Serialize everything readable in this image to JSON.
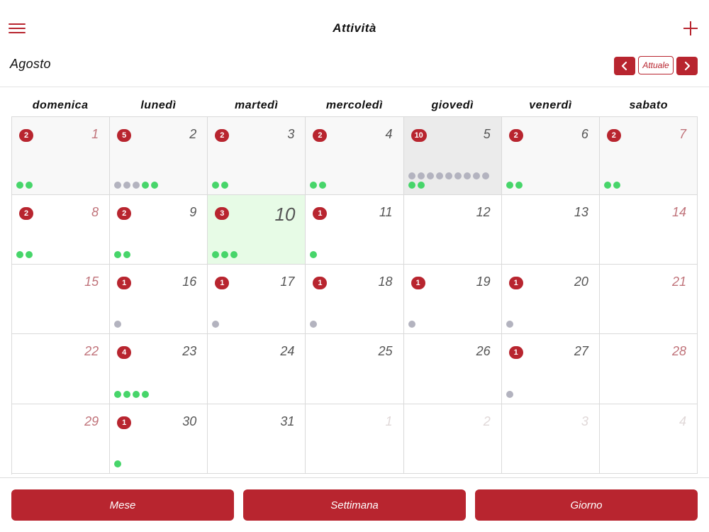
{
  "header": {
    "title": "Attività",
    "month": "Agosto",
    "today_label": "Attuale"
  },
  "colors": {
    "accent": "#b8252f",
    "event_green": "#47d56a",
    "event_gray": "#b3b3bf",
    "today_bg": "#e7fbe6",
    "selected_bg": "#ebebeb"
  },
  "weekdays": [
    "domenica",
    "lunedì",
    "martedì",
    "mercoledì",
    "giovedì",
    "venerdì",
    "sabato"
  ],
  "weeks": [
    [
      {
        "day": "1",
        "badge": "2",
        "dots": [
          "green",
          "green"
        ],
        "weekend": true,
        "state": "past"
      },
      {
        "day": "2",
        "badge": "5",
        "dots": [
          "gray",
          "gray",
          "gray",
          "green",
          "green"
        ],
        "state": "past"
      },
      {
        "day": "3",
        "badge": "2",
        "dots": [
          "green",
          "green"
        ],
        "state": "past"
      },
      {
        "day": "4",
        "badge": "2",
        "dots": [
          "green",
          "green"
        ],
        "state": "past"
      },
      {
        "day": "5",
        "badge": "10",
        "dots": [
          "gray",
          "gray",
          "gray",
          "gray",
          "gray",
          "gray",
          "gray",
          "gray",
          "gray",
          "green",
          "green"
        ],
        "state": "selected"
      },
      {
        "day": "6",
        "badge": "2",
        "dots": [
          "green",
          "green"
        ],
        "state": "past"
      },
      {
        "day": "7",
        "badge": "2",
        "dots": [
          "green",
          "green"
        ],
        "weekend": true,
        "state": "past"
      }
    ],
    [
      {
        "day": "8",
        "badge": "2",
        "dots": [
          "green",
          "green"
        ],
        "weekend": true
      },
      {
        "day": "9",
        "badge": "2",
        "dots": [
          "green",
          "green"
        ]
      },
      {
        "day": "10",
        "badge": "3",
        "dots": [
          "green",
          "green",
          "green"
        ],
        "state": "today"
      },
      {
        "day": "11",
        "badge": "1",
        "dots": [
          "green"
        ]
      },
      {
        "day": "12",
        "badge": "",
        "dots": []
      },
      {
        "day": "13",
        "badge": "",
        "dots": []
      },
      {
        "day": "14",
        "badge": "",
        "dots": [],
        "weekend": true
      }
    ],
    [
      {
        "day": "15",
        "badge": "",
        "dots": [],
        "weekend": true
      },
      {
        "day": "16",
        "badge": "1",
        "dots": [
          "gray"
        ]
      },
      {
        "day": "17",
        "badge": "1",
        "dots": [
          "gray"
        ]
      },
      {
        "day": "18",
        "badge": "1",
        "dots": [
          "gray"
        ]
      },
      {
        "day": "19",
        "badge": "1",
        "dots": [
          "gray"
        ]
      },
      {
        "day": "20",
        "badge": "1",
        "dots": [
          "gray"
        ]
      },
      {
        "day": "21",
        "badge": "",
        "dots": [],
        "weekend": true
      }
    ],
    [
      {
        "day": "22",
        "badge": "",
        "dots": [],
        "weekend": true
      },
      {
        "day": "23",
        "badge": "4",
        "dots": [
          "green",
          "green",
          "green",
          "green"
        ]
      },
      {
        "day": "24",
        "badge": "",
        "dots": []
      },
      {
        "day": "25",
        "badge": "",
        "dots": []
      },
      {
        "day": "26",
        "badge": "",
        "dots": []
      },
      {
        "day": "27",
        "badge": "1",
        "dots": [
          "gray"
        ]
      },
      {
        "day": "28",
        "badge": "",
        "dots": [],
        "weekend": true
      }
    ],
    [
      {
        "day": "29",
        "badge": "",
        "dots": [],
        "weekend": true
      },
      {
        "day": "30",
        "badge": "1",
        "dots": [
          "green"
        ]
      },
      {
        "day": "31",
        "badge": "",
        "dots": []
      },
      {
        "day": "1",
        "badge": "",
        "dots": [],
        "other": true
      },
      {
        "day": "2",
        "badge": "",
        "dots": [],
        "other": true
      },
      {
        "day": "3",
        "badge": "",
        "dots": [],
        "other": true
      },
      {
        "day": "4",
        "badge": "",
        "dots": [],
        "other": true
      }
    ]
  ],
  "bottom": {
    "month_label": "Mese",
    "week_label": "Settimana",
    "day_label": "Giorno"
  }
}
